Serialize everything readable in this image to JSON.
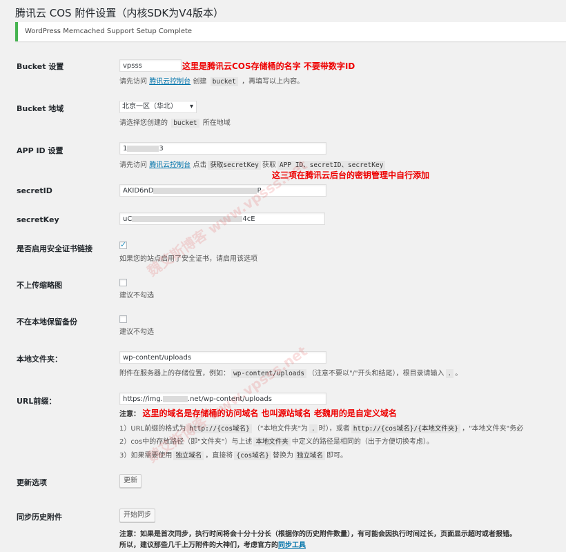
{
  "title": "腾讯云 COS 附件设置（内核SDK为V4版本）",
  "notice": "WordPress Memcached Support Setup Complete",
  "bucket": {
    "label": "Bucket 设置",
    "value": "vpsss",
    "annotation": "这里是腾讯云COS存储桶的名字  不要带数字ID",
    "desc_prefix": "请先访问",
    "desc_link": "腾讯云控制台",
    "desc_mid": "创建",
    "desc_code": "bucket",
    "desc_suffix": "，再填写以上内容。"
  },
  "region": {
    "label": "Bucket 地域",
    "selected": "北京一区（华北）",
    "desc_prefix": "请选择您创建的",
    "desc_code": "bucket",
    "desc_suffix": "所在地域"
  },
  "appid": {
    "label": "APP ID 设置",
    "value_start": "1",
    "value_end": "3",
    "desc_prefix": "请先访问",
    "desc_link": "腾讯云控制台",
    "desc_mid": "点击",
    "desc_code1": "获取secretKey",
    "desc_mid2": "获取",
    "desc_code2": "APP ID、secretID、secretKey",
    "annotation": "这三项在腾讯云后台的密钥管理中自行添加"
  },
  "secretid": {
    "label": "secretID",
    "value_start": "AKID6nD",
    "value_end": "P"
  },
  "secretkey": {
    "label": "secretKey",
    "value_start": "uC",
    "value_end": "4cE"
  },
  "https": {
    "label": "是否启用安全证书链接",
    "desc": "如果您的站点启用了安全证书，请启用该选项"
  },
  "nothumb": {
    "label": "不上传缩略图",
    "desc": "建议不勾选"
  },
  "nolocal": {
    "label": "不在本地保留备份",
    "desc": "建议不勾选"
  },
  "folder": {
    "label": "本地文件夹：",
    "value": "wp-content/uploads",
    "desc_prefix": "附件在服务器上的存储位置，例如：",
    "desc_code": "wp-content/uploads",
    "desc_mid": "（注意不要以\"/\"开头和结尾），根目录请输入",
    "desc_code2": ".",
    "desc_suffix": "。"
  },
  "urlprefix": {
    "label": "URL前缀：",
    "value_start": "https://img.",
    "value_end": ".net/wp-content/uploads",
    "note_label": "注意：",
    "annotation": "这里的域名是存储桶的访问域名  也叫源站域名  老魏用的是自定义域名",
    "line1_prefix": "1）URL前缀的格式为",
    "line1_code1": "http://{cos域名}",
    "line1_mid": "（\"本地文件夹\"为",
    "line1_code2": ".",
    "line1_mid2": "时），或者",
    "line1_code3": "http://{cos域名}/{本地文件夹}",
    "line1_suffix": "，\"本地文件夹\"务必",
    "line2_prefix": "2）cos中的存放路径（即\"文件夹\"）与上述",
    "line2_code": "本地文件夹",
    "line2_suffix": "中定义的路径是相同的（出于方便切换考虑）。",
    "line3_prefix": "3）如果需要使用",
    "line3_code1": "独立域名",
    "line3_mid": "，直接将",
    "line3_code2": "{cos域名}",
    "line3_mid2": "替换为",
    "line3_code3": "独立域名",
    "line3_suffix": "即可。"
  },
  "update": {
    "label": "更新选项",
    "button": "更新"
  },
  "sync": {
    "label": "同步历史附件",
    "button": "开始同步",
    "note1": "注意：如果是首次同步，执行时间将会十分十分长（根据你的历史附件数量），有可能会因执行时间过长，页面显示超时或者报错。",
    "note2_prefix": "所以，建议那些几千上万附件的大神们，考虑官方的",
    "note2_link": "同步工具"
  },
  "watermark": "魏艾斯博客 www.vpsss.net"
}
